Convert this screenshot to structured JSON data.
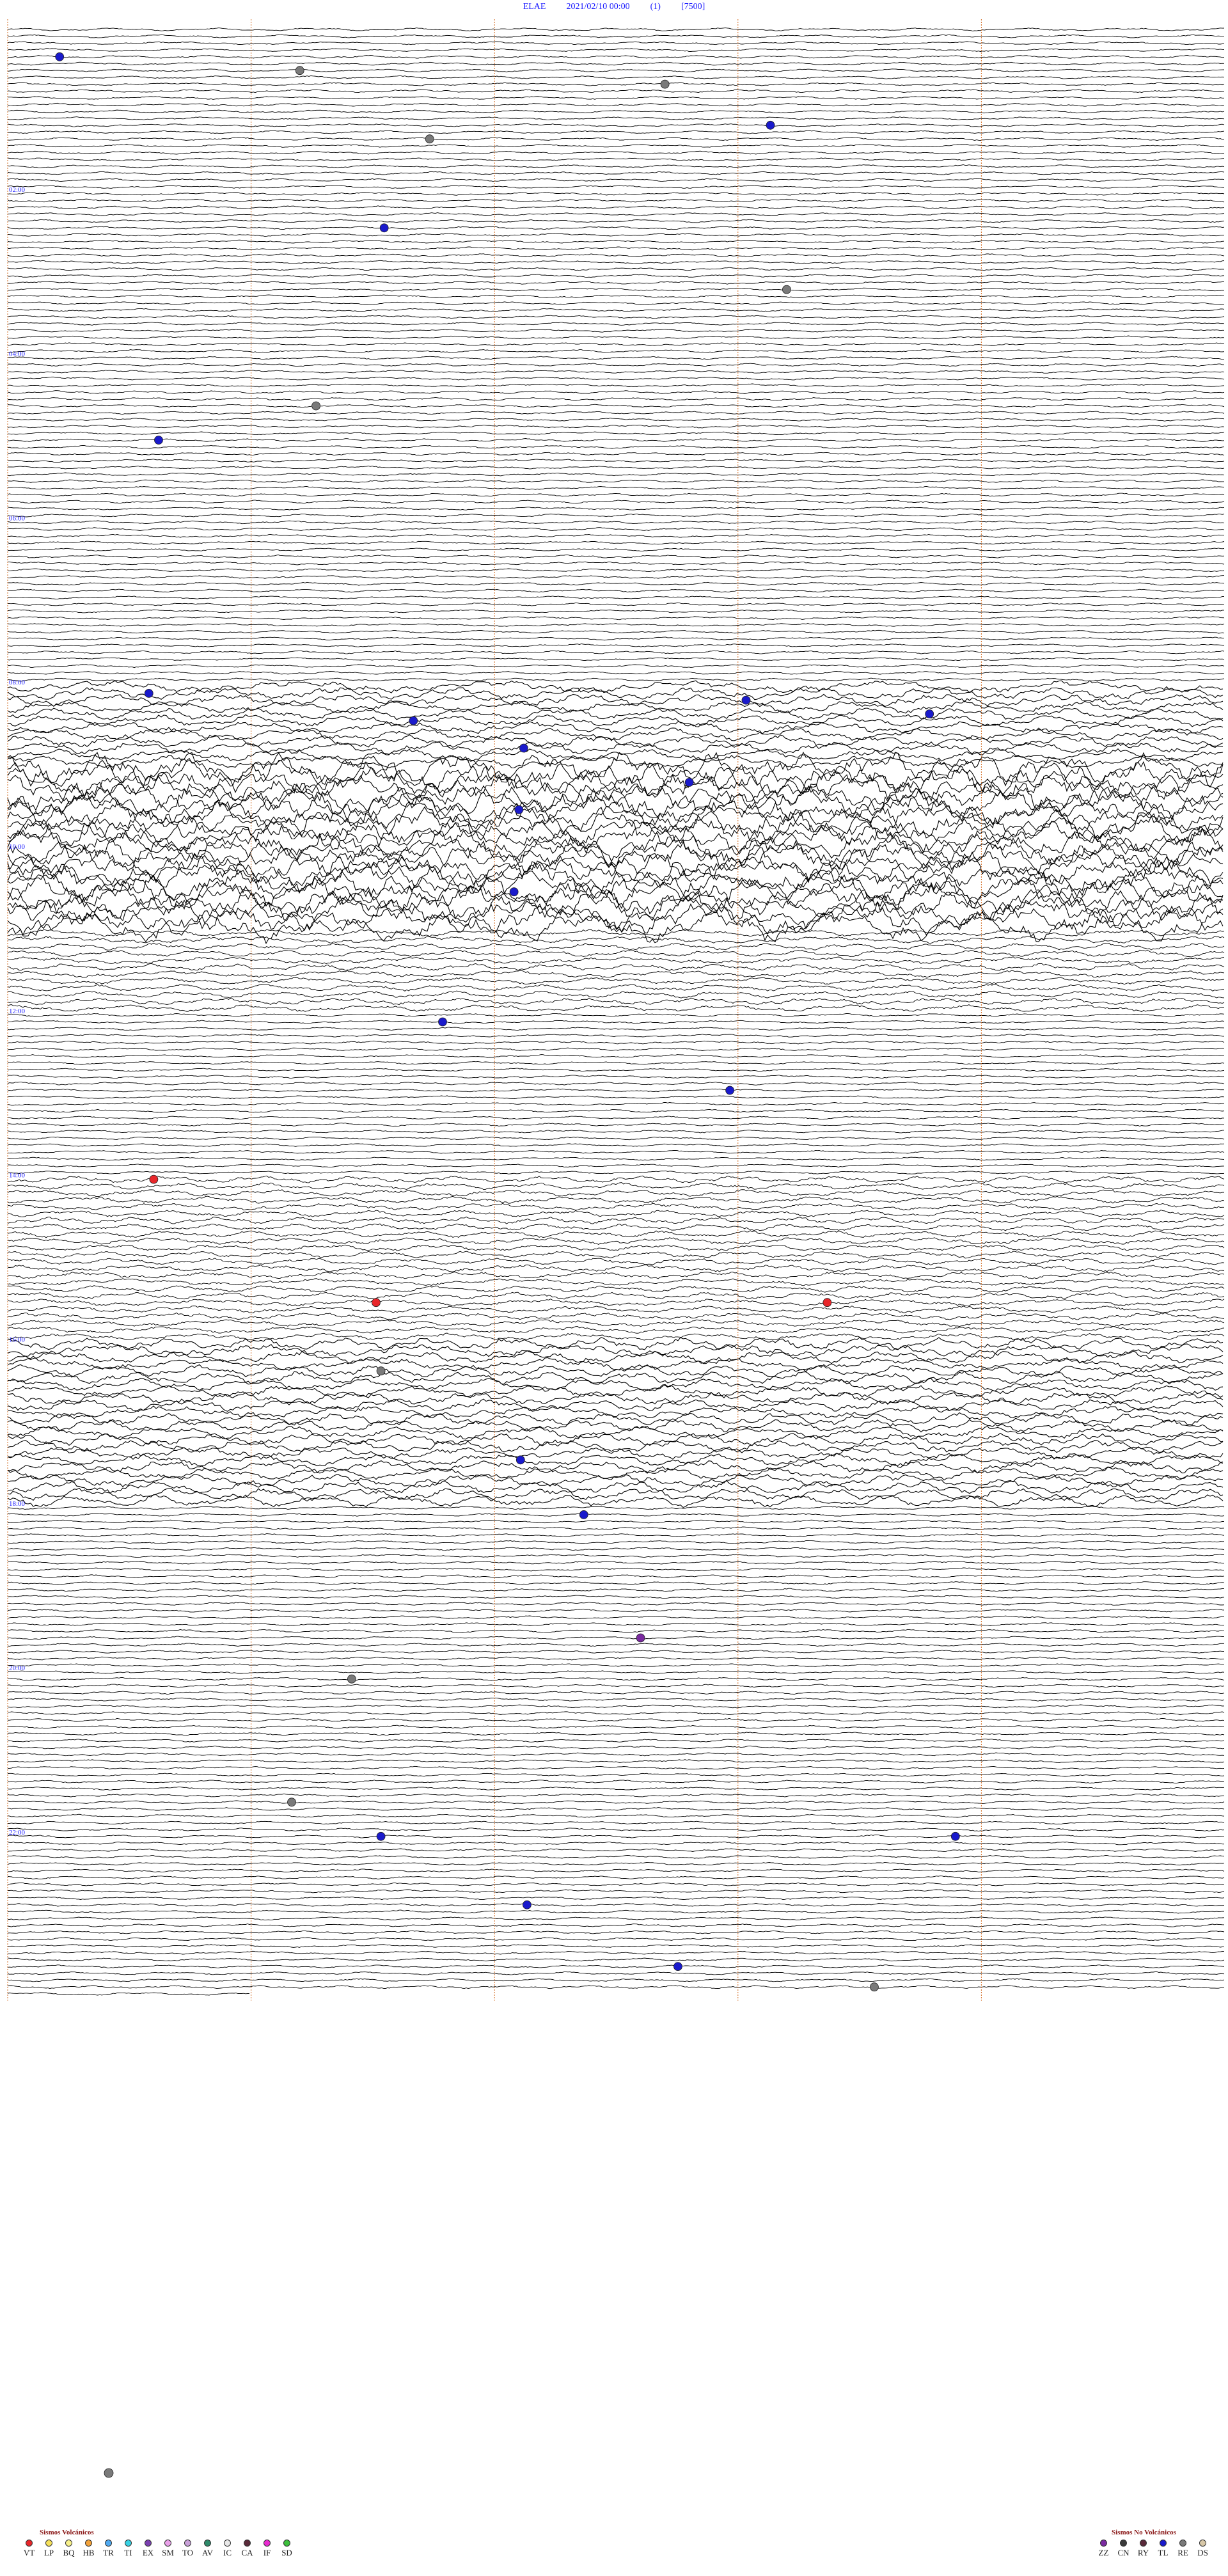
{
  "header": {
    "station": "ELAE",
    "datetime": "2021/02/10 00:00",
    "component": "(1)",
    "scale": "[7500]"
  },
  "chart_data": {
    "type": "line",
    "title": "ELAE 2021/02/10 00:00 (1) [7500]",
    "hour_labels": [
      "02:00",
      "04:00",
      "06:00",
      "08:00",
      "10:00",
      "12:00",
      "14:00",
      "16:00",
      "18:00",
      "20:00",
      "22:00"
    ],
    "minute_markers": [
      15,
      30,
      45,
      60
    ],
    "traces_per_hour": 12,
    "total_traces": 288,
    "activity": [
      {
        "from_hour": 0.0,
        "to_hour": 8.0,
        "level": "low"
      },
      {
        "from_hour": 8.0,
        "to_hour": 9.0,
        "level": "high"
      },
      {
        "from_hour": 9.0,
        "to_hour": 11.0,
        "level": "very_high"
      },
      {
        "from_hour": 11.0,
        "to_hour": 12.0,
        "level": "moderate"
      },
      {
        "from_hour": 12.0,
        "to_hour": 14.0,
        "level": "low"
      },
      {
        "from_hour": 14.0,
        "to_hour": 16.0,
        "level": "moderate"
      },
      {
        "from_hour": 16.0,
        "to_hour": 18.0,
        "level": "high"
      },
      {
        "from_hour": 18.0,
        "to_hour": 24.0,
        "level": "low"
      }
    ],
    "events": [
      {
        "hour": 0.35,
        "minute": 3.2,
        "type": "TL"
      },
      {
        "hour": 0.47,
        "minute": 18.0,
        "type": "RE"
      },
      {
        "hour": 0.65,
        "minute": 40.5,
        "type": "RE"
      },
      {
        "hour": 1.15,
        "minute": 47.0,
        "type": "TL"
      },
      {
        "hour": 1.3,
        "minute": 26.0,
        "type": "RE"
      },
      {
        "hour": 2.45,
        "minute": 23.2,
        "type": "TL"
      },
      {
        "hour": 3.2,
        "minute": 48.0,
        "type": "RE"
      },
      {
        "hour": 4.6,
        "minute": 19.0,
        "type": "RE"
      },
      {
        "hour": 5.0,
        "minute": 9.3,
        "type": "TL"
      },
      {
        "hour": 8.1,
        "minute": 8.7,
        "type": "TL"
      },
      {
        "hour": 8.2,
        "minute": 45.5,
        "type": "TL"
      },
      {
        "hour": 8.3,
        "minute": 56.8,
        "type": "TL"
      },
      {
        "hour": 8.45,
        "minute": 25.0,
        "type": "TL"
      },
      {
        "hour": 8.75,
        "minute": 31.8,
        "type": "TL"
      },
      {
        "hour": 9.15,
        "minute": 42.0,
        "type": "TL"
      },
      {
        "hour": 9.5,
        "minute": 31.5,
        "type": "TL"
      },
      {
        "hour": 10.5,
        "minute": 31.2,
        "type": "TL"
      },
      {
        "hour": 12.1,
        "minute": 26.8,
        "type": "TL"
      },
      {
        "hour": 12.9,
        "minute": 44.5,
        "type": "TL"
      },
      {
        "hour": 14.0,
        "minute": 9.0,
        "type": "VT"
      },
      {
        "hour": 15.5,
        "minute": 22.7,
        "type": "VT"
      },
      {
        "hour": 15.5,
        "minute": 50.5,
        "type": "VT"
      },
      {
        "hour": 16.35,
        "minute": 23.0,
        "type": "RE"
      },
      {
        "hour": 17.45,
        "minute": 31.6,
        "type": "TL"
      },
      {
        "hour": 18.1,
        "minute": 35.5,
        "type": "TL"
      },
      {
        "hour": 19.6,
        "minute": 39.0,
        "type": "ZZ"
      },
      {
        "hour": 20.1,
        "minute": 21.2,
        "type": "RE"
      },
      {
        "hour": 21.6,
        "minute": 17.5,
        "type": "RE"
      },
      {
        "hour": 22.0,
        "minute": 23.0,
        "type": "TL"
      },
      {
        "hour": 22.0,
        "minute": 58.4,
        "type": "TL"
      },
      {
        "hour": 22.8,
        "minute": 32.0,
        "type": "TL"
      },
      {
        "hour": 23.6,
        "minute": 41.3,
        "type": "TL"
      },
      {
        "hour": 23.85,
        "minute": 53.4,
        "type": "RE"
      }
    ]
  },
  "legend": {
    "volcanic_title": "Sismos Volcánicos",
    "nonvolcanic_title": "Sismos No Volcánicos",
    "volcanic": [
      {
        "code": "VT",
        "color": "#e8262a"
      },
      {
        "code": "LP",
        "color": "#f5e05a"
      },
      {
        "code": "BQ",
        "color": "#f7f08a"
      },
      {
        "code": "HB",
        "color": "#f2a23a"
      },
      {
        "code": "TR",
        "color": "#4fa9f0"
      },
      {
        "code": "TI",
        "color": "#37d1e3"
      },
      {
        "code": "EX",
        "color": "#7a3fb0"
      },
      {
        "code": "SM",
        "color": "#e9a0e9"
      },
      {
        "code": "TO",
        "color": "#c8a0d8"
      },
      {
        "code": "AV",
        "color": "#2e8a6a"
      },
      {
        "code": "IC",
        "color": "#e8e8e8"
      },
      {
        "code": "CA",
        "color": "#5a2a3a"
      },
      {
        "code": "IF",
        "color": "#e82ad0"
      },
      {
        "code": "SD",
        "color": "#3bbf3b"
      }
    ],
    "nonvolcanic": [
      {
        "code": "ZZ",
        "color": "#7a2aa0"
      },
      {
        "code": "CN",
        "color": "#3a3a3a"
      },
      {
        "code": "RY",
        "color": "#5a2a3a"
      },
      {
        "code": "TL",
        "color": "#1a1acc"
      },
      {
        "code": "RE",
        "color": "#7a7a7a"
      },
      {
        "code": "DS",
        "color": "#d8c8a8"
      }
    ]
  },
  "colors": {
    "header_text": "#1a1aff",
    "hour_label": "#1a1aff",
    "trace": "#000000",
    "minute_marker": "#d2691e",
    "legend_title": "#8b1a1a"
  }
}
